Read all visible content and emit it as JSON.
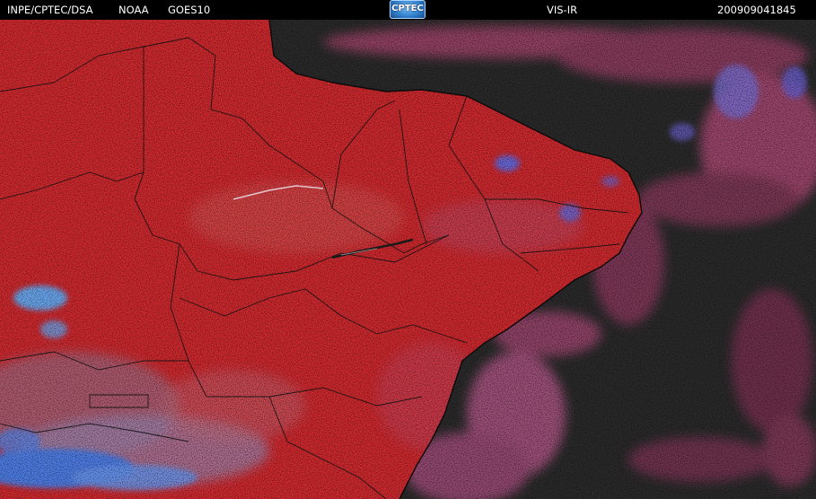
{
  "header": {
    "agency": "INPE/CPTEC/DSA",
    "operator": "NOAA",
    "satellite": "GOES10",
    "logo_text": "CPTEC",
    "channel": "VIS-IR",
    "timestamp": "200909041845"
  },
  "colors": {
    "land": "#d42a2e",
    "ocean": "#2b2b2b",
    "cloud_pink": "#c45a86",
    "cloud_blue": "#5a78e6",
    "border": "#000000"
  }
}
